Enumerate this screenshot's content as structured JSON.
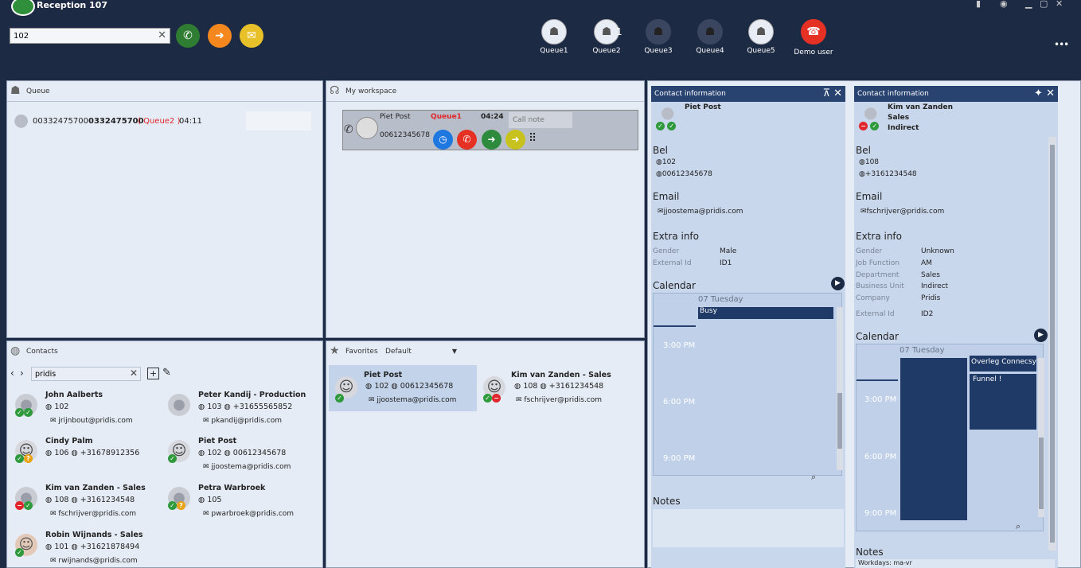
{
  "app": {
    "title": "Reception  107"
  },
  "toolbar": {
    "search_value": "102",
    "call_icon": "phone-icon",
    "transfer_icon": "arrow-right-icon",
    "mail_icon": "envelope-icon",
    "queues": [
      {
        "label": "Queue1",
        "count": ""
      },
      {
        "label": "Queue2",
        "count": "1"
      },
      {
        "label": "Queue3",
        "count": ""
      },
      {
        "label": "Queue4",
        "count": ""
      },
      {
        "label": "Queue5",
        "count": ""
      }
    ],
    "user_label": "Demo user",
    "colors": {
      "call": "#2e7d32",
      "transfer": "#f5871f",
      "mail": "#e8c02a",
      "demo_user": "#e53124"
    }
  },
  "queue_panel": {
    "title": "Queue",
    "row": {
      "number": "00332475700",
      "number_bold": "0332475700",
      "queue": "( Queue2 )",
      "time": "04:11"
    }
  },
  "workspace_panel": {
    "title": "My workspace",
    "call": {
      "name": "Piet Post",
      "queue": "Queue1",
      "time": "04:24",
      "number": "00612345678",
      "note_placeholder": "Call note"
    }
  },
  "contacts_panel": {
    "title": "Contacts",
    "search_value": "pridis",
    "contacts": [
      {
        "name": "John Aalberts",
        "ext": "102",
        "phone": "",
        "email": "jrijnbout@pridis.com"
      },
      {
        "name": "Peter Kandij  - Production",
        "ext": "103",
        "phone": "+31655565852",
        "email": "pkandij@pridis.com"
      },
      {
        "name": "Cindy Palm",
        "ext": "106",
        "phone": "+31678912356",
        "email": ""
      },
      {
        "name": "Piet Post",
        "ext": "102",
        "phone": "00612345678",
        "email": "jjoostema@pridis.com"
      },
      {
        "name": "Kim van Zanden  - Sales",
        "ext": "108",
        "phone": "+3161234548",
        "email": "fschrijver@pridis.com"
      },
      {
        "name": "Petra Warbroek",
        "ext": "105",
        "phone": "",
        "email": "pwarbroek@pridis.com"
      },
      {
        "name": "Robin Wijnands  - Sales",
        "ext": "101",
        "phone": "+31621878494",
        "email": "rwijnands@pridis.com"
      }
    ]
  },
  "favorites_panel": {
    "title": "Favorites",
    "selected_list": "Default",
    "items": [
      {
        "name": "Piet Post",
        "ext": "102",
        "phone": "00612345678",
        "email": "jjoostema@pridis.com"
      },
      {
        "name": "Kim van Zanden  - Sales",
        "ext": "108",
        "phone": "+3161234548",
        "email": "fschrijver@pridis.com"
      }
    ]
  },
  "contact_info_1": {
    "header": "Contact information",
    "name": "Piet Post",
    "bel_title": "Bel",
    "bel": [
      "102",
      "00612345678"
    ],
    "email_title": "Email",
    "email": "jjoostema@pridis.com",
    "extra_title": "Extra info",
    "extra": [
      {
        "label": "Gender",
        "value": "Male"
      },
      {
        "label": "External Id",
        "value": "ID1"
      }
    ],
    "calendar_title": "Calendar",
    "calendar_day": "07 Tuesday",
    "calendar_times": [
      "3:00 PM",
      "6:00 PM",
      "9:00 PM"
    ],
    "event": "Busy",
    "notes_title": "Notes"
  },
  "contact_info_2": {
    "header": "Contact information",
    "name": "Kim van Zanden",
    "sub1": "Sales",
    "sub2": "Indirect",
    "bel_title": "Bel",
    "bel": [
      "108",
      "+3161234548"
    ],
    "email_title": "Email",
    "email": "fschrijver@pridis.com",
    "extra_title": "Extra info",
    "extra": [
      {
        "label": "Gender",
        "value": "Unknown"
      },
      {
        "label": "Job Function",
        "value": "AM"
      },
      {
        "label": "Department",
        "value": "Sales"
      },
      {
        "label": "Business Unit",
        "value": "Indirect"
      },
      {
        "label": "Company",
        "value": "Pridis"
      },
      {
        "label": "External Id",
        "value": "ID2"
      }
    ],
    "calendar_title": "Calendar",
    "calendar_day": "07 Tuesday",
    "calendar_times": [
      "3:00 PM",
      "6:00 PM",
      "9:00 PM"
    ],
    "events": [
      "Overleg Connecsy",
      "Funnel !"
    ],
    "notes_title": "Notes",
    "notes_text": "Workdays: ma-vr"
  }
}
